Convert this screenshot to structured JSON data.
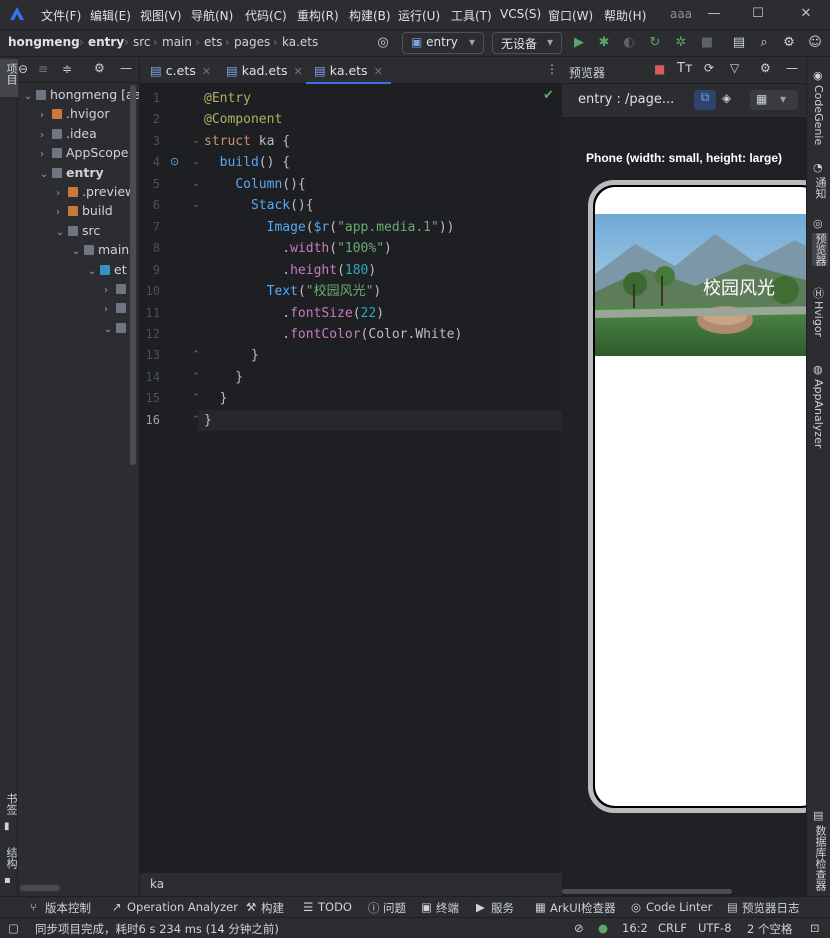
{
  "menu": [
    "文件(F)",
    "编辑(E)",
    "视图(V)",
    "导航(N)",
    "代码(C)",
    "重构(R)",
    "构建(B)",
    "运行(U)",
    "工具(T)",
    "VCS(S)",
    "窗口(W)",
    "帮助(H)"
  ],
  "project_name_title": "aaa",
  "breadcrumbs": [
    "hongmeng",
    "entry",
    "src",
    "main",
    "ets",
    "pages",
    "ka.ets"
  ],
  "run_config": "entry",
  "device": "无设备",
  "left_strip": {
    "project_label": "项目",
    "bookmarks_label": "书签",
    "structure_label": "结构"
  },
  "tree": [
    {
      "label": "hongmeng [aa",
      "indent": 0,
      "arrow": "v",
      "color": "#6e7681"
    },
    {
      "label": ".hvigor",
      "indent": 1,
      "arrow": ">",
      "color": "#c97a3a"
    },
    {
      "label": ".idea",
      "indent": 1,
      "arrow": ">",
      "color": "#6e7681"
    },
    {
      "label": "AppScope",
      "indent": 1,
      "arrow": ">",
      "color": "#6e7681"
    },
    {
      "label": "entry",
      "indent": 1,
      "arrow": "v",
      "color": "#6e7681"
    },
    {
      "label": ".preview",
      "indent": 2,
      "arrow": ">",
      "color": "#c97a3a"
    },
    {
      "label": "build",
      "indent": 2,
      "arrow": ">",
      "color": "#c97a3a"
    },
    {
      "label": "src",
      "indent": 2,
      "arrow": "v",
      "color": "#6e7681"
    },
    {
      "label": "main",
      "indent": 3,
      "arrow": "v",
      "color": "#6e7681"
    },
    {
      "label": "et",
      "indent": 4,
      "arrow": "v",
      "color": "#3592c4"
    },
    {
      "label": "",
      "indent": 5,
      "arrow": ">",
      "color": "#6e7681"
    },
    {
      "label": "",
      "indent": 5,
      "arrow": ">",
      "color": "#6e7681"
    },
    {
      "label": "",
      "indent": 5,
      "arrow": "v",
      "color": "#6e7681"
    }
  ],
  "tabs": [
    {
      "label": "c.ets",
      "active": false
    },
    {
      "label": "kad.ets",
      "active": false
    },
    {
      "label": "ka.ets",
      "active": true
    }
  ],
  "code_lines": [
    "@Entry",
    "@Component",
    "struct ka {",
    "  build() {",
    "    Column(){",
    "      Stack(){",
    "        Image($r(\"app.media.1\"))",
    "          .width(\"100%\")",
    "          .height(180)",
    "        Text(\"校园风光\")",
    "          .fontSize(22)",
    "          .fontColor(Color.White)",
    "      }",
    "    }",
    "  }",
    "}"
  ],
  "editor_breadcrumb": "ka",
  "preview": {
    "panel_title": "预览器",
    "route": "entry : /page...",
    "device_label": "Phone (width: small, height: large)",
    "overlay_text": "校园风光"
  },
  "right_strip": [
    "CodeGenie",
    "通知",
    "预览器",
    "Hvigor",
    "AppAnalyzer",
    "数据库检查器"
  ],
  "bottom_tools": [
    "版本控制",
    "Operation Analyzer",
    "构建",
    "TODO",
    "问题",
    "终端",
    "服务",
    "ArkUI检查器",
    "Code Linter",
    "预览器日志"
  ],
  "status": {
    "message": "同步项目完成，耗时6 s 234 ms (14 分钟之前)",
    "position": "16:2",
    "line_sep": "CRLF",
    "encoding": "UTF-8",
    "indent": "2 个空格"
  },
  "colors": {
    "accent": "#3574f0",
    "run_green": "#59a869",
    "stop_red": "#db5c5c"
  }
}
